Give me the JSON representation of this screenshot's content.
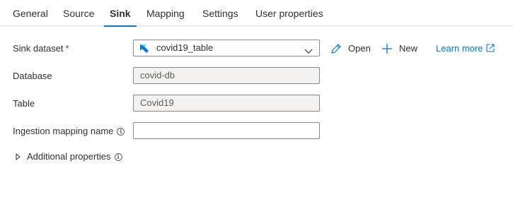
{
  "tabs": [
    {
      "label": "General",
      "active": false
    },
    {
      "label": "Source",
      "active": false
    },
    {
      "label": "Sink",
      "active": true
    },
    {
      "label": "Mapping",
      "active": false
    },
    {
      "label": "Settings",
      "active": false
    },
    {
      "label": "User properties",
      "active": false
    }
  ],
  "sink_dataset": {
    "label": "Sink dataset",
    "required_marker": "*",
    "value": "covid19_table",
    "icon": "kusto-dataset-icon"
  },
  "actions": {
    "open_label": "Open",
    "new_label": "New",
    "learn_more_label": "Learn more"
  },
  "database": {
    "label": "Database",
    "value": "covid-db"
  },
  "table": {
    "label": "Table",
    "value": "Covid19"
  },
  "ingestion_mapping": {
    "label": "Ingestion mapping name",
    "value": ""
  },
  "additional_properties": {
    "label": "Additional properties",
    "expanded": false
  },
  "colors": {
    "accent": "#0078d4",
    "required": "#a4262c",
    "readonly_bg": "#f3f2f1"
  }
}
